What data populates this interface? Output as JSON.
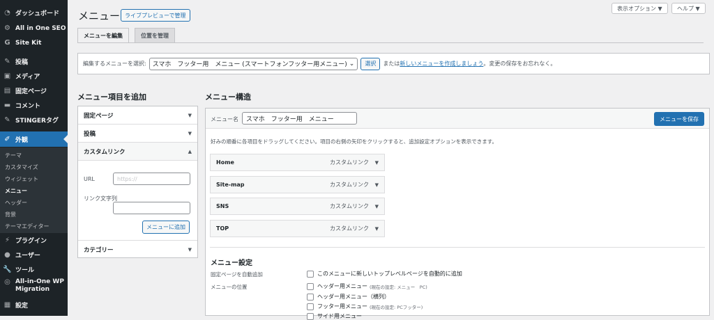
{
  "sidebar": {
    "items": [
      {
        "label": "ダッシュボード",
        "icon": "dashboard-icon",
        "glyph": "◔"
      },
      {
        "label": "All in One SEO",
        "icon": "gear-icon",
        "glyph": "⚙"
      },
      {
        "label": "Site Kit",
        "icon": "google-g-icon",
        "glyph": "G"
      },
      {
        "label": "投稿",
        "icon": "pin-icon",
        "glyph": "✎"
      },
      {
        "label": "メディア",
        "icon": "media-icon",
        "glyph": "▣"
      },
      {
        "label": "固定ページ",
        "icon": "page-icon",
        "glyph": "▤"
      },
      {
        "label": "コメント",
        "icon": "comment-icon",
        "glyph": "▬"
      },
      {
        "label": "STINGERタグ",
        "icon": "pin-icon",
        "glyph": "✎"
      },
      {
        "label": "外観",
        "icon": "brush-icon",
        "glyph": "✐"
      },
      {
        "label": "プラグイン",
        "icon": "plugin-icon",
        "glyph": "⚡"
      },
      {
        "label": "ユーザー",
        "icon": "user-icon",
        "glyph": "●"
      },
      {
        "label": "ツール",
        "icon": "wrench-icon",
        "glyph": "🔧"
      },
      {
        "label": "All-in-One WP Migration",
        "icon": "migration-icon",
        "glyph": "◎"
      },
      {
        "label": "設定",
        "icon": "settings-icon",
        "glyph": "▦"
      }
    ],
    "submenu": [
      "テーマ",
      "カスタマイズ",
      "ウィジェット",
      "メニュー",
      "ヘッダー",
      "背景",
      "テーマエディター"
    ]
  },
  "top": {
    "screen_options": "表示オプション ▼",
    "help": "ヘルプ ▼"
  },
  "page": {
    "title": "メニュー",
    "preview_button": "ライブプレビューで管理"
  },
  "tabs": [
    "メニューを編集",
    "位置を管理"
  ],
  "select_bar": {
    "label": "編集するメニューを選択:",
    "selected": "スマホ　フッター用　メニュー (スマートフォンフッター用メニュー)",
    "select_button": "選択",
    "or_text": "または",
    "create_link": "新しいメニューを作成しましょう",
    "suffix": "。変更の保存をお忘れなく。"
  },
  "add_items": {
    "heading": "メニュー項目を追加",
    "sections": [
      "固定ページ",
      "投稿",
      "カスタムリンク",
      "カテゴリー"
    ],
    "url_label": "URL",
    "url_placeholder": "https://",
    "link_text_label": "リンク文字列",
    "add_button": "メニューに追加"
  },
  "structure": {
    "heading": "メニュー構造",
    "name_label": "メニュー名",
    "name_value": "スマホ　フッター用　メニュー",
    "save_button": "メニューを保存",
    "help": "好みの順番に各項目をドラッグしてください。項目の右側の矢印をクリックすると、追加設定オプションを表示できます。",
    "items": [
      {
        "title": "Home",
        "type": "カスタムリンク"
      },
      {
        "title": "Site-map",
        "type": "カスタムリンク"
      },
      {
        "title": "SNS",
        "type": "カスタムリンク"
      },
      {
        "title": "TOP",
        "type": "カスタムリンク"
      }
    ]
  },
  "settings": {
    "heading": "メニュー設定",
    "auto_add_label": "固定ページを自動追加",
    "auto_add_option": "このメニューに新しいトップレベルページを自動的に追加",
    "location_label": "メニューの位置",
    "locations": [
      {
        "label": "ヘッダー用メニュー",
        "note": "(現在の設定: メニュー　PC)"
      },
      {
        "label": "ヘッダー用メニュー（横列）",
        "note": ""
      },
      {
        "label": "フッター用メニュー",
        "note": "(現在の設定: PCフッター)"
      },
      {
        "label": "サイド用メニュー",
        "note": ""
      }
    ]
  },
  "colors": {
    "accent": "#2271b1",
    "sidebar_bg": "#1d2327"
  }
}
